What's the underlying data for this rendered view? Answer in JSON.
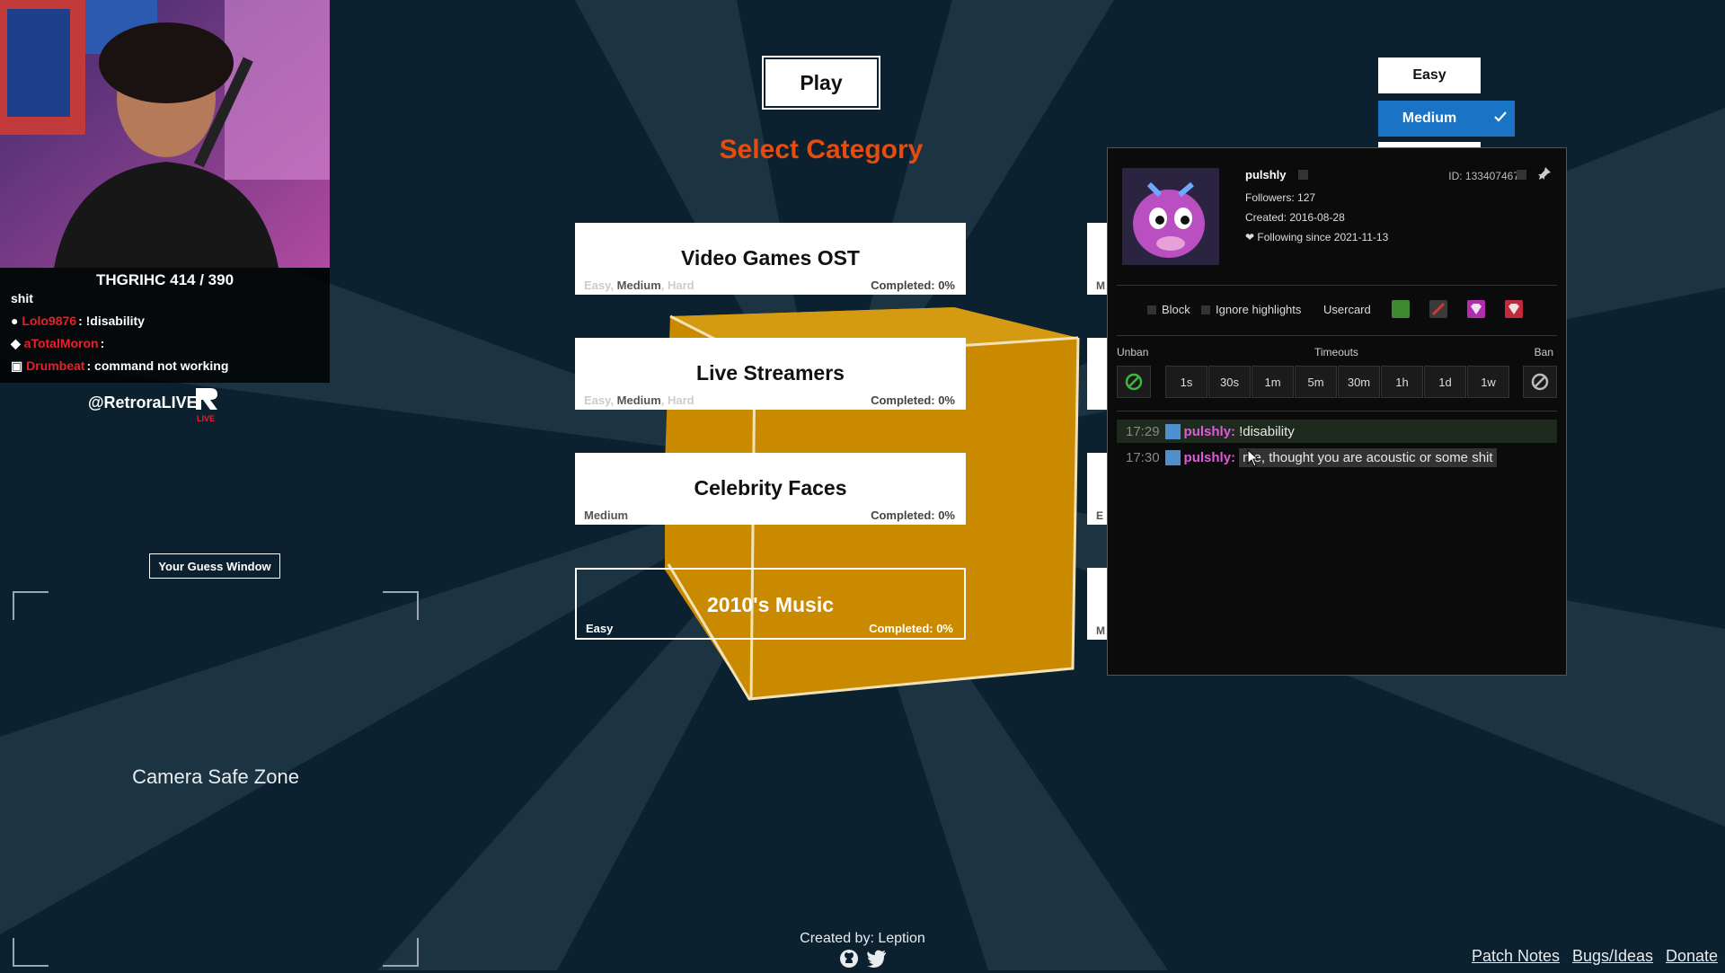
{
  "colors": {
    "accent_orange": "#e84b0e",
    "medium_blue": "#1a73c5",
    "cube_gold": "#c98a00",
    "bg": "#0b2130",
    "username_pink": "#e05adc"
  },
  "stream": {
    "score": "THGRIHC 414 / 390",
    "chat": [
      {
        "user": "",
        "text": "shit"
      },
      {
        "user": "Lolo9876",
        "text": "!disability",
        "color": "#e8202a"
      },
      {
        "user": "aTotalMoron",
        "text": "",
        "color": "#e8202a"
      },
      {
        "user": "Drumbeat",
        "text": "command not working",
        "color": "#e8202a"
      }
    ],
    "handle": "@RetroraLIVE",
    "logo_sub": "LIVE"
  },
  "guess_window": "Your Guess Window",
  "camera_safe_zone": "Camera Safe Zone",
  "game": {
    "play_label": "Play",
    "select_title": "Select Category",
    "categories": [
      {
        "name": "Video Games OST",
        "difficulties": [
          "Easy",
          "Medium",
          "Hard"
        ],
        "available": [
          false,
          true,
          false
        ],
        "completed": "Completed: 0%"
      },
      {
        "name": "Live Streamers",
        "difficulties": [
          "Easy",
          "Medium",
          "Hard"
        ],
        "available": [
          false,
          true,
          false
        ],
        "completed": "Completed: 0%"
      },
      {
        "name": "Celebrity Faces",
        "difficulties": [
          "Medium"
        ],
        "available": [
          true
        ],
        "completed": "Completed: 0%"
      },
      {
        "name": "2010's Music",
        "difficulties": [
          "Easy"
        ],
        "available": [
          true
        ],
        "completed": "Completed: 0%"
      }
    ],
    "edge_cards": [
      "M",
      "",
      "",
      "E",
      "M"
    ]
  },
  "difficulty": {
    "easy": "Easy",
    "medium": "Medium",
    "selected": "Medium"
  },
  "usercard": {
    "username": "pulshly",
    "id": "ID: 133407467",
    "followers": "Followers: 127",
    "created": "Created: 2016-08-28",
    "following": "Following since 2021-11-13",
    "block": "Block",
    "ignore": "Ignore highlights",
    "usercard": "Usercard",
    "unban": "Unban",
    "timeouts": "Timeouts",
    "ban": "Ban",
    "timeout_options": [
      "1s",
      "30s",
      "1m",
      "5m",
      "30m",
      "1h",
      "1d",
      "1w"
    ],
    "messages": [
      {
        "time": "17:29",
        "user": "pulshly:",
        "text": "!disability"
      },
      {
        "time": "17:30",
        "user": "pulshly:",
        "text": "me, thought you are acoustic or some shit"
      }
    ]
  },
  "footer": {
    "created": "Created by: Leption",
    "links": [
      "Patch Notes",
      "Bugs/Ideas",
      "Donate"
    ]
  }
}
